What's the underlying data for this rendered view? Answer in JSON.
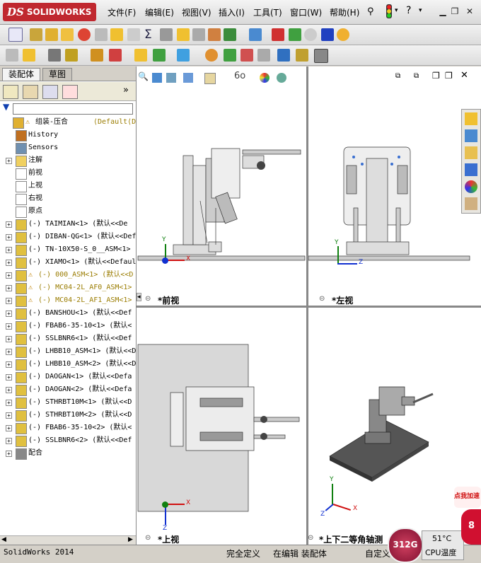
{
  "app": {
    "logo_text": "SOLIDWORKS",
    "logo_mark": "DS"
  },
  "menu": [
    "文件(F)",
    "编辑(E)",
    "视图(V)",
    "插入(I)",
    "工具(T)",
    "窗口(W)",
    "帮助(H)"
  ],
  "panel": {
    "tabs": [
      "装配体",
      "草图"
    ],
    "tree": [
      {
        "label": "组装-压合",
        "suffix": "⟨Default⟨Defau",
        "expand": "",
        "warn": true,
        "icon": "assembly-warning-icon"
      },
      {
        "label": "History",
        "icon": "history-icon"
      },
      {
        "label": "Sensors",
        "icon": "sensors-icon"
      },
      {
        "label": "注解",
        "icon": "annotation-icon",
        "expand": "+"
      },
      {
        "label": "前视",
        "icon": "plane-icon"
      },
      {
        "label": "上视",
        "icon": "plane-icon"
      },
      {
        "label": "右视",
        "icon": "plane-icon"
      },
      {
        "label": "原点",
        "icon": "origin-icon"
      },
      {
        "label": "(-) TAIMIAN<1> (默认<<De",
        "icon": "part-icon",
        "expand": "+"
      },
      {
        "label": "(-) DIBAN-QG<1> (默认<<Def",
        "icon": "part-icon",
        "expand": "+"
      },
      {
        "label": "(-) TN-10X50-S_0__ASM<1>",
        "icon": "part-icon",
        "expand": "+"
      },
      {
        "label": "(-) XIAMO<1> (默认<<Default",
        "icon": "part-icon",
        "expand": "+"
      },
      {
        "label": "(-) 000_ASM<1> (默认<<D",
        "icon": "part-warn-icon",
        "expand": "+",
        "warn": true
      },
      {
        "label": "(-) MC04-2L_AF0_ASM<1>",
        "icon": "part-warn-icon",
        "expand": "+",
        "warn": true
      },
      {
        "label": "(-) MC04-2L_AF1_ASM<1>",
        "icon": "part-warn-icon",
        "expand": "+",
        "warn": true
      },
      {
        "label": "(-) BANSHOU<1> (默认<<Def",
        "icon": "part-icon",
        "expand": "+"
      },
      {
        "label": "(-) FBAB6-35-10<1> (默认<",
        "icon": "part-icon",
        "expand": "+"
      },
      {
        "label": "(-) SSLBNR6<1> (默认<<Def",
        "icon": "part-icon",
        "expand": "+"
      },
      {
        "label": "(-) LHBB10_ASM<1> (默认<<D",
        "icon": "part-icon",
        "expand": "+"
      },
      {
        "label": "(-) LHBB10_ASM<2> (默认<<D",
        "icon": "part-icon",
        "expand": "+"
      },
      {
        "label": "(-) DAOGAN<1> (默认<<Defa",
        "icon": "part-icon",
        "expand": "+"
      },
      {
        "label": "(-) DAOGAN<2> (默认<<Defa",
        "icon": "part-icon",
        "expand": "+"
      },
      {
        "label": "(-) STHRBT10M<1> (默认<<D",
        "icon": "part-icon",
        "expand": "+"
      },
      {
        "label": "(-) STHRBT10M<2> (默认<<D",
        "icon": "part-icon",
        "expand": "+"
      },
      {
        "label": "(-) FBAB6-35-10<2> (默认<",
        "icon": "part-icon",
        "expand": "+"
      },
      {
        "label": "(-) SSLBNR6<2> (默认<<Def",
        "icon": "part-icon",
        "expand": "+"
      },
      {
        "label": "配合",
        "icon": "mates-icon",
        "expand": "+"
      }
    ]
  },
  "views": {
    "front": "*前视",
    "left": "*左视",
    "top": "*上视",
    "iso": "*上下二等角轴测"
  },
  "axes": {
    "x": "X",
    "y": "Y",
    "z": "Z"
  },
  "status": {
    "version": "SolidWorks 2014",
    "state": "完全定义",
    "editing": "在编辑 装配体",
    "custom": "自定义"
  },
  "widget": {
    "temp": "51°C",
    "temp_label": "CPU温度",
    "dial": "312G",
    "promo": "点我加速",
    "badge": "8"
  },
  "colors": {
    "accent": "#c0282f",
    "axis_x": "#d01010",
    "axis_y": "#108010",
    "axis_z": "#1030d0"
  }
}
